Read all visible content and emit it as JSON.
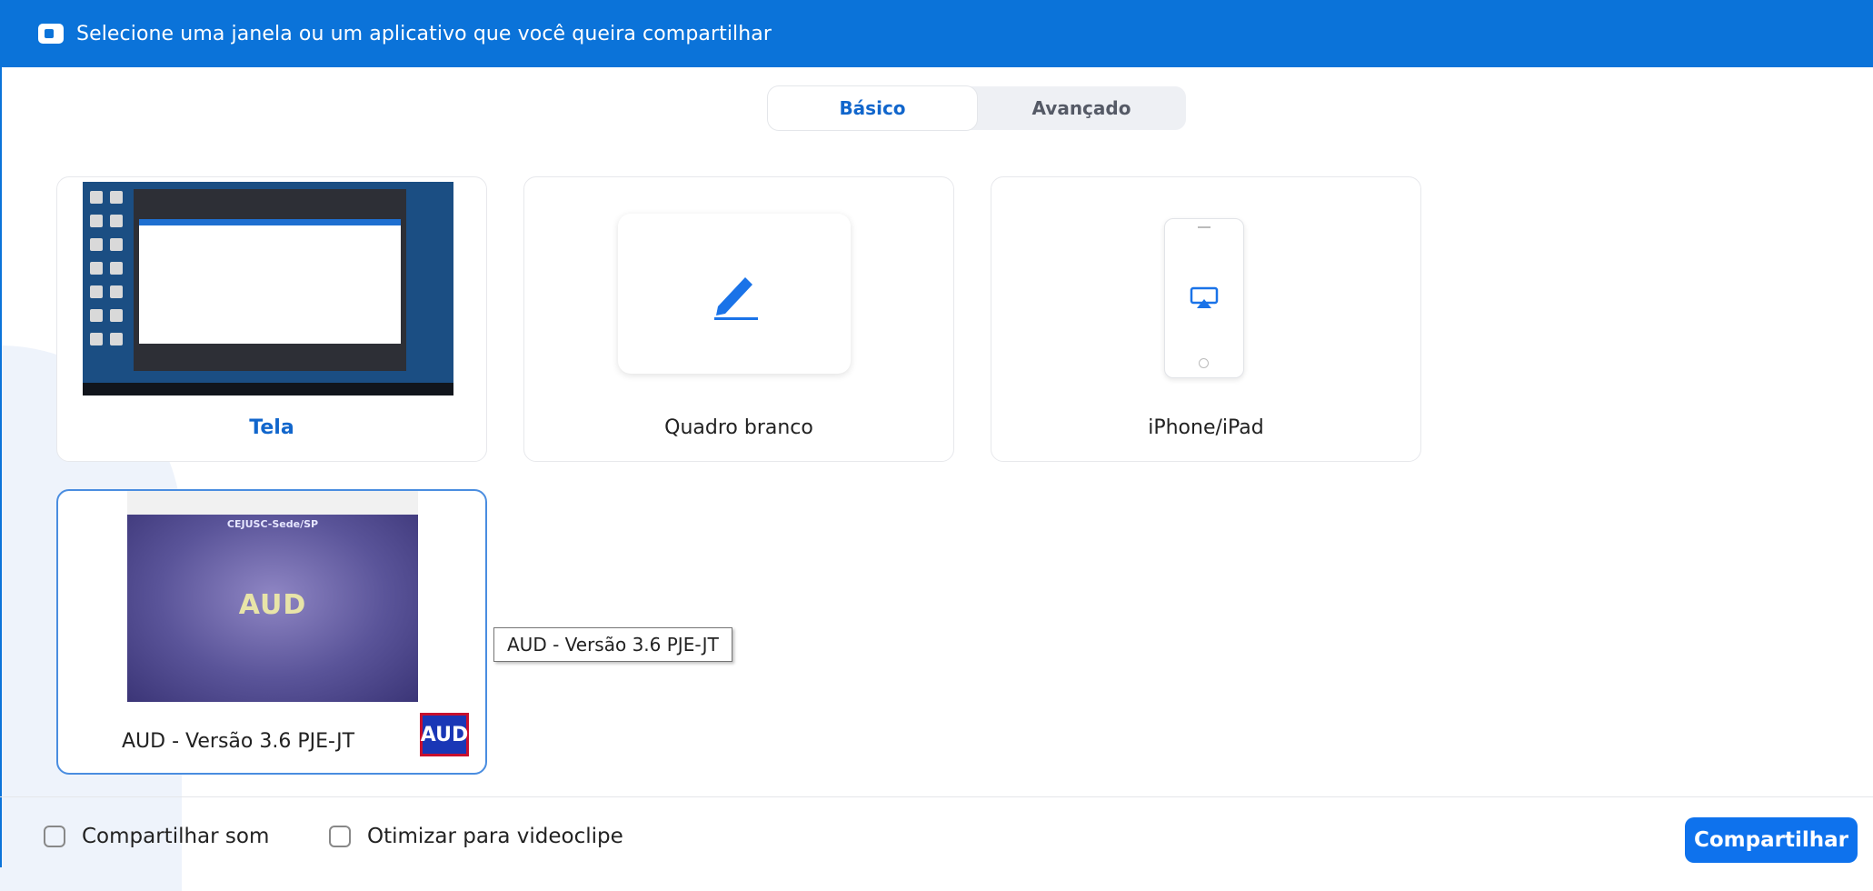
{
  "window": {
    "title": "Selecione uma janela ou um aplicativo que você queira compartilhar"
  },
  "tabs": [
    {
      "label": "Básico",
      "active": true
    },
    {
      "label": "Avançado",
      "active": false
    }
  ],
  "cards": {
    "screen": {
      "label": "Tela"
    },
    "whiteboard": {
      "label": "Quadro branco"
    },
    "iphone": {
      "label": "iPhone/iPad"
    },
    "aud": {
      "label": "AUD - Versão 3.6 PJE-JT",
      "icon_text": "AUD",
      "preview_heading": "CEJUSC-Sede/SP",
      "preview_logo": "AUD"
    }
  },
  "tooltip": {
    "text": "AUD - Versão 3.6 PJE-JT"
  },
  "footer": {
    "share_sound_label": "Compartilhar som",
    "optimize_video_label": "Otimizar para videoclipe",
    "share_button_label": "Compartilhar"
  },
  "colors": {
    "titlebar": "#0b73d9",
    "accent": "#0e72ed",
    "active_tab_text": "#1166cc"
  }
}
